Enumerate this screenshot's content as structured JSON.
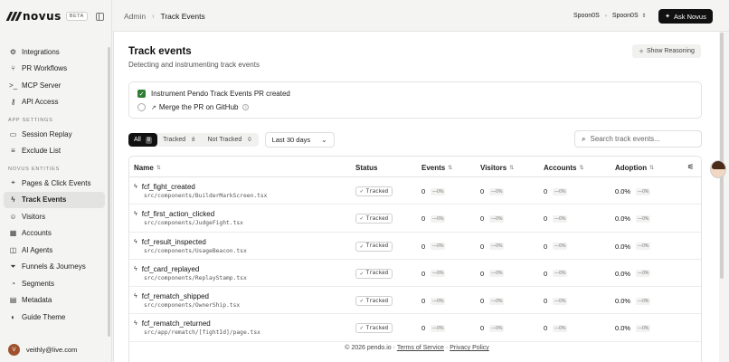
{
  "app": {
    "logo_text": "novus",
    "beta_label": "BETA"
  },
  "sidebar": {
    "items_top": [
      {
        "label": "Integrations",
        "icon": "puzzle-icon"
      },
      {
        "label": "PR Workflows",
        "icon": "git-pull-request-icon"
      },
      {
        "label": "MCP Server",
        "icon": "terminal-icon"
      },
      {
        "label": "API Access",
        "icon": "key-icon"
      }
    ],
    "section_app_settings": "APP SETTINGS",
    "items_settings": [
      {
        "label": "Session Replay",
        "icon": "video-icon"
      },
      {
        "label": "Exclude List",
        "icon": "list-icon"
      }
    ],
    "section_entities": "NOVUS ENTITIES",
    "items_entities": [
      {
        "label": "Pages & Click Events",
        "icon": "pointer-icon"
      },
      {
        "label": "Track Events",
        "icon": "bolt-icon",
        "active": true
      },
      {
        "label": "Visitors",
        "icon": "user-icon"
      },
      {
        "label": "Accounts",
        "icon": "building-icon"
      },
      {
        "label": "AI Agents",
        "icon": "robot-icon"
      },
      {
        "label": "Funnels & Journeys",
        "icon": "funnel-icon"
      },
      {
        "label": "Segments",
        "icon": "segments-icon"
      },
      {
        "label": "Metadata",
        "icon": "database-icon"
      },
      {
        "label": "Guide Theme",
        "icon": "palette-icon"
      }
    ],
    "user": {
      "initial": "V",
      "email": "veithly@live.com"
    }
  },
  "topbar": {
    "breadcrumb_root": "Admin",
    "breadcrumb_current": "Track Events",
    "workspace_org": "Spoon0S",
    "workspace_app": "Spoon0S",
    "ask_button": "Ask Novus"
  },
  "page": {
    "title": "Track events",
    "subtitle": "Detecting and instrumenting track events",
    "reasoning_button": "Show Reasoning",
    "steps": {
      "step1": "Instrument Pendo Track Events PR created",
      "step2": "Merge the PR on GitHub"
    },
    "filters": {
      "all_label": "All",
      "all_count": "8",
      "tracked_label": "Tracked",
      "tracked_count": "8",
      "not_tracked_label": "Not Tracked",
      "not_tracked_count": "0",
      "range": "Last 30 days"
    },
    "search_placeholder": "Search track events..."
  },
  "table": {
    "headers": {
      "name": "Name",
      "status": "Status",
      "events": "Events",
      "visitors": "Visitors",
      "accounts": "Accounts",
      "adoption": "Adoption"
    },
    "rows": [
      {
        "name": "fcf_fight_created",
        "path": "src/components/BuilderMarkScreen.tsx",
        "status": "Tracked",
        "events": "0",
        "visitors": "0",
        "accounts": "0",
        "adoption": "0.0%",
        "delta": "—0%"
      },
      {
        "name": "fcf_first_action_clicked",
        "path": "src/components/JudgeFight.tsx",
        "status": "Tracked",
        "events": "0",
        "visitors": "0",
        "accounts": "0",
        "adoption": "0.0%",
        "delta": "—0%"
      },
      {
        "name": "fcf_result_inspected",
        "path": "src/components/UsageBeacon.tsx",
        "status": "Tracked",
        "events": "0",
        "visitors": "0",
        "accounts": "0",
        "adoption": "0.0%",
        "delta": "—0%"
      },
      {
        "name": "fcf_card_replayed",
        "path": "src/components/ReplayStamp.tsx",
        "status": "Tracked",
        "events": "0",
        "visitors": "0",
        "accounts": "0",
        "adoption": "0.0%",
        "delta": "—0%"
      },
      {
        "name": "fcf_rematch_shipped",
        "path": "src/components/OwnerShip.tsx",
        "status": "Tracked",
        "events": "0",
        "visitors": "0",
        "accounts": "0",
        "adoption": "0.0%",
        "delta": "—0%"
      },
      {
        "name": "fcf_rematch_returned",
        "path": "src/app/rematch/[fightId]/page.tsx",
        "status": "Tracked",
        "events": "0",
        "visitors": "0",
        "accounts": "0",
        "adoption": "0.0%",
        "delta": "—0%"
      }
    ]
  },
  "footer": {
    "copyright": "© 2026 pendo.io ·",
    "terms": "Terms of Service",
    "dot": "·",
    "privacy": "Privacy Policy"
  }
}
